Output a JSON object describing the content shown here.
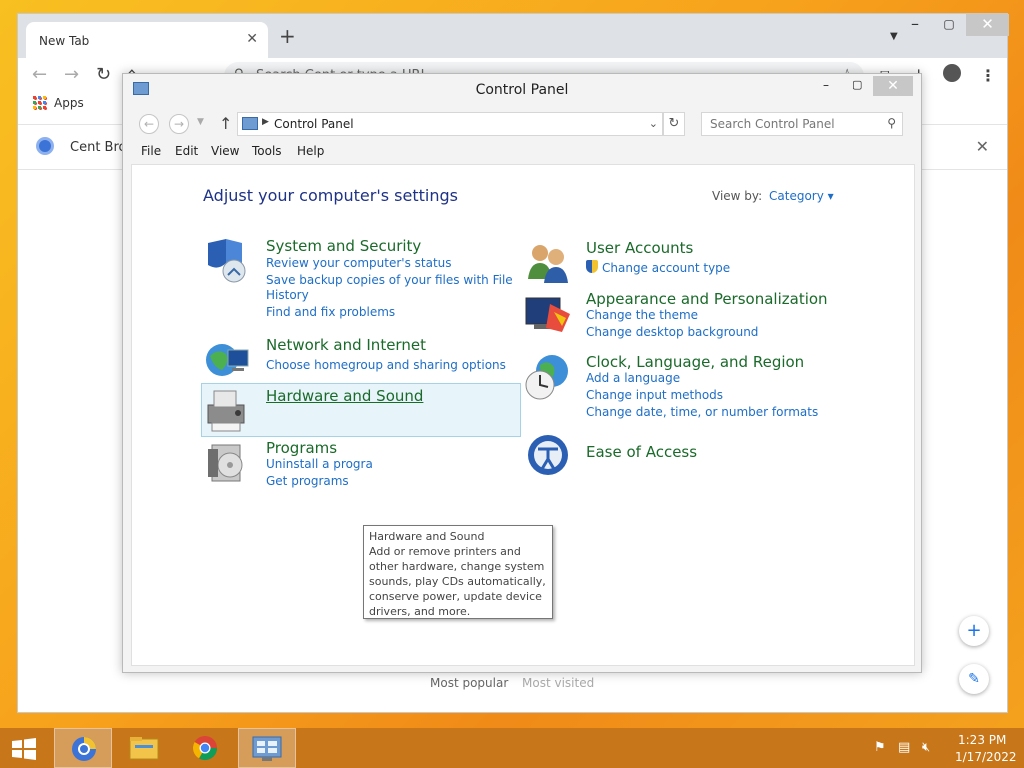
{
  "browser": {
    "tab_title": "New Tab",
    "new_tab": "+",
    "omnibox_placeholder": "Search Cent or type a URL",
    "apps_label": "Apps",
    "infobar_text": "Cent Brow",
    "most_popular": "Most popular",
    "most_visited": "Most visited"
  },
  "control_panel": {
    "title": "Control Panel",
    "address": "Control Panel",
    "search_placeholder": "Search Control Panel",
    "menu": [
      "File",
      "Edit",
      "View",
      "Tools",
      "Help"
    ],
    "heading": "Adjust your computer's settings",
    "view_by_label": "View by:",
    "view_by_value": "Category",
    "categories": [
      {
        "title": "System and Security",
        "links": [
          "Review your computer's status",
          "Save backup copies of your files with File",
          "History",
          "Find and fix problems"
        ],
        "icon": "shield-icon"
      },
      {
        "title": "Network and Internet",
        "links": [
          "Choose homegroup and sharing options"
        ],
        "icon": "globe-network-icon"
      },
      {
        "title": "Hardware and Sound",
        "links": [],
        "icon": "printer-icon"
      },
      {
        "title": "Programs",
        "links": [
          "Uninstall a progra",
          "Get programs"
        ],
        "icon": "programs-icon"
      },
      {
        "title": "User Accounts",
        "links": [
          "Change account type"
        ],
        "icon": "users-icon"
      },
      {
        "title": "Appearance and Personalization",
        "links": [
          "Change the theme",
          "Change desktop background"
        ],
        "icon": "monitor-palette-icon"
      },
      {
        "title": "Clock, Language, and Region",
        "links": [
          "Add a language",
          "Change input methods",
          "Change date, time, or number formats"
        ],
        "icon": "clock-globe-icon"
      },
      {
        "title": "Ease of Access",
        "links": [],
        "icon": "ease-of-access-icon"
      }
    ],
    "tooltip": {
      "title": "Hardware and Sound",
      "body": "Add or remove printers and other hardware, change system sounds, play CDs automatically, conserve power, update device drivers, and more."
    }
  },
  "taskbar": {
    "time": "1:23 PM",
    "date": "1/17/2022"
  },
  "colors": {
    "desktop": "#f7a21c",
    "taskbar": "#c77619",
    "link_blue": "#1e6ec7",
    "category_green": "#1a6a2a",
    "heading_blue": "#1e3287"
  }
}
